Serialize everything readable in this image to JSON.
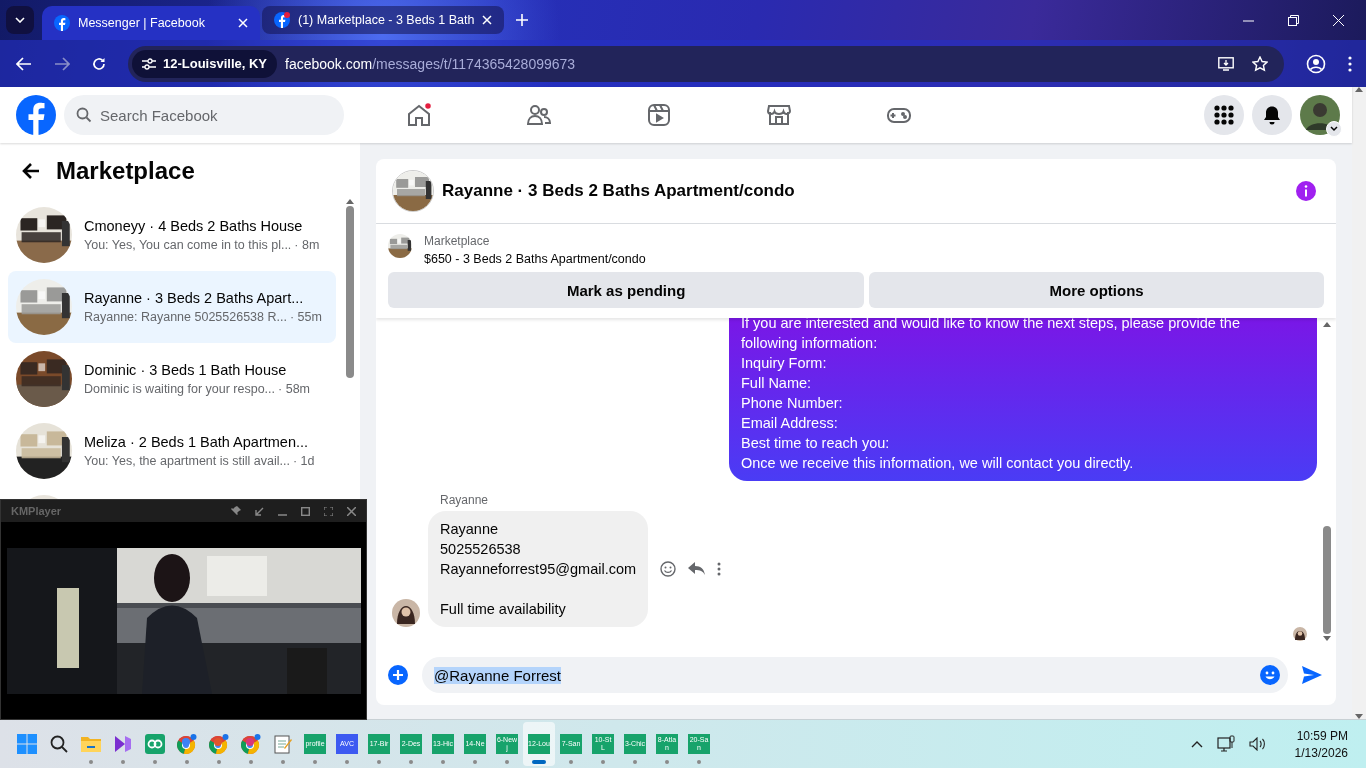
{
  "browser": {
    "tabs": [
      {
        "title": "Messenger | Facebook",
        "selected": true,
        "notification": false
      },
      {
        "title": "(1) Marketplace - 3 Beds 1 Bath",
        "selected": false,
        "notification": true
      }
    ],
    "site_chip": "12-Louisville, KY",
    "url_host": "facebook.com",
    "url_path": "/messages/t/1174365428099673"
  },
  "header": {
    "search": {
      "placeholder": "Search Facebook"
    },
    "nav": [
      {
        "kind": "home",
        "badge": true
      },
      {
        "kind": "friends",
        "badge": false
      },
      {
        "kind": "video",
        "badge": false
      },
      {
        "kind": "marketplace",
        "badge": false
      },
      {
        "kind": "gaming",
        "badge": false
      }
    ]
  },
  "sidebar": {
    "title": "Marketplace",
    "conversations": [
      {
        "title": "Cmoneyy · 4 Beds 2 Baths House",
        "preview": "You: Yes, You can come in to this pl...",
        "time": "· 8m",
        "selected": false
      },
      {
        "title": "Rayanne · 3 Beds 2 Baths Apart...",
        "preview": "Rayanne: Rayanne 5025526538 R...",
        "time": "· 55m",
        "selected": true
      },
      {
        "title": "Dominic · 3 Beds 1 Bath House",
        "preview": "Dominic is waiting for your respo...",
        "time": "· 58m",
        "selected": false
      },
      {
        "title": "Meliza · 2 Beds 1 Bath Apartmen...",
        "preview": "You: Yes, the apartment is still avail...",
        "time": "· 1d",
        "selected": false
      }
    ]
  },
  "thread": {
    "title": "Rayanne · 3 Beds 2 Baths Apartment/condo",
    "listing": {
      "label": "Marketplace",
      "description": "$650 - 3 Beds 2 Baths Apartment/condo"
    },
    "buttons": [
      "Mark as pending",
      "More options"
    ],
    "messages": [
      {
        "kind": "outgoing",
        "text": "If you are interested and would like to know the next steps, please provide the\nfollowing information:\nInquiry Form:\nFull Name:\nPhone Number:\nEmail Address:\nBest time to reach you:\nOnce we receive this information, we will contact you directly."
      },
      {
        "kind": "incoming",
        "sender": "Rayanne",
        "text": "Rayanne\n5025526538\nRayanneforrest95@gmail.com\n\nFull time availability"
      }
    ],
    "composer": {
      "value": "@Rayanne Forrest"
    }
  },
  "media_player": {
    "title": "KMPlayer"
  },
  "taskbar": {
    "apps": [
      {
        "kind": "start",
        "running": false,
        "selected": false
      },
      {
        "kind": "search",
        "running": false,
        "selected": false
      },
      {
        "kind": "folder",
        "running": true,
        "selected": false
      },
      {
        "kind": "studio",
        "running": true,
        "selected": false
      },
      {
        "kind": "loop",
        "running": true,
        "selected": false
      },
      {
        "kind": "browser",
        "running": true,
        "selected": false,
        "color": "#3b82f6"
      },
      {
        "kind": "browser",
        "running": true,
        "selected": false,
        "color": "#e0552b"
      },
      {
        "kind": "browser",
        "running": true,
        "selected": false,
        "color": "#d9367a"
      },
      {
        "kind": "notepad",
        "running": true,
        "selected": false
      },
      {
        "kind": "tile",
        "label": "profile",
        "running": true,
        "selected": false,
        "color": "#17a36b"
      },
      {
        "kind": "tile",
        "label": "AVC",
        "running": true,
        "selected": false,
        "color": "#3d5af1"
      },
      {
        "kind": "tile",
        "label": "17-Bir",
        "running": true,
        "selected": false,
        "color": "#17a36b"
      },
      {
        "kind": "tile",
        "label": "2-Des",
        "running": true,
        "selected": false,
        "color": "#17a36b"
      },
      {
        "kind": "tile",
        "label": "13-Hic",
        "running": true,
        "selected": false,
        "color": "#17a36b"
      },
      {
        "kind": "tile",
        "label": "14-Ne",
        "running": true,
        "selected": false,
        "color": "#17a36b"
      },
      {
        "kind": "tile",
        "label": "6-New j",
        "running": true,
        "selected": false,
        "color": "#17a36b"
      },
      {
        "kind": "tile",
        "label": "12-Lou",
        "running": true,
        "selected": true,
        "color": "#17a36b"
      },
      {
        "kind": "tile",
        "label": "7-San",
        "running": true,
        "selected": false,
        "color": "#17a36b"
      },
      {
        "kind": "tile",
        "label": "10-St L",
        "running": true,
        "selected": false,
        "color": "#17a36b"
      },
      {
        "kind": "tile",
        "label": "3-Chic",
        "running": true,
        "selected": false,
        "color": "#17a36b"
      },
      {
        "kind": "tile",
        "label": "8-Atlan",
        "running": true,
        "selected": false,
        "color": "#17a36b"
      },
      {
        "kind": "tile",
        "label": "20-San",
        "running": true,
        "selected": false,
        "color": "#17a36b"
      }
    ],
    "time": "10:59 PM",
    "date": "1/13/2026"
  }
}
